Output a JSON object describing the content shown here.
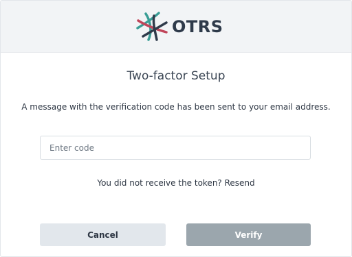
{
  "header": {
    "logo_text": "OTRS",
    "logo_icon": "otrs-logo-icon"
  },
  "main": {
    "title": "Two-factor Setup",
    "message": "A message with the verification code has been sent to your email address.",
    "code_input": {
      "placeholder": "Enter code",
      "value": ""
    },
    "resend": {
      "prefix": "You did not receive the token?",
      "link_label": "Resend"
    }
  },
  "actions": {
    "cancel_label": "Cancel",
    "verify_label": "Verify"
  },
  "colors": {
    "header_bg": "#f2f4f6",
    "logo_teal": "#3a9e96",
    "logo_red": "#c0455a",
    "logo_dark": "#2e3a4a",
    "cancel_bg": "#e2e7ec",
    "verify_bg_disabled": "#9ba6ad"
  }
}
